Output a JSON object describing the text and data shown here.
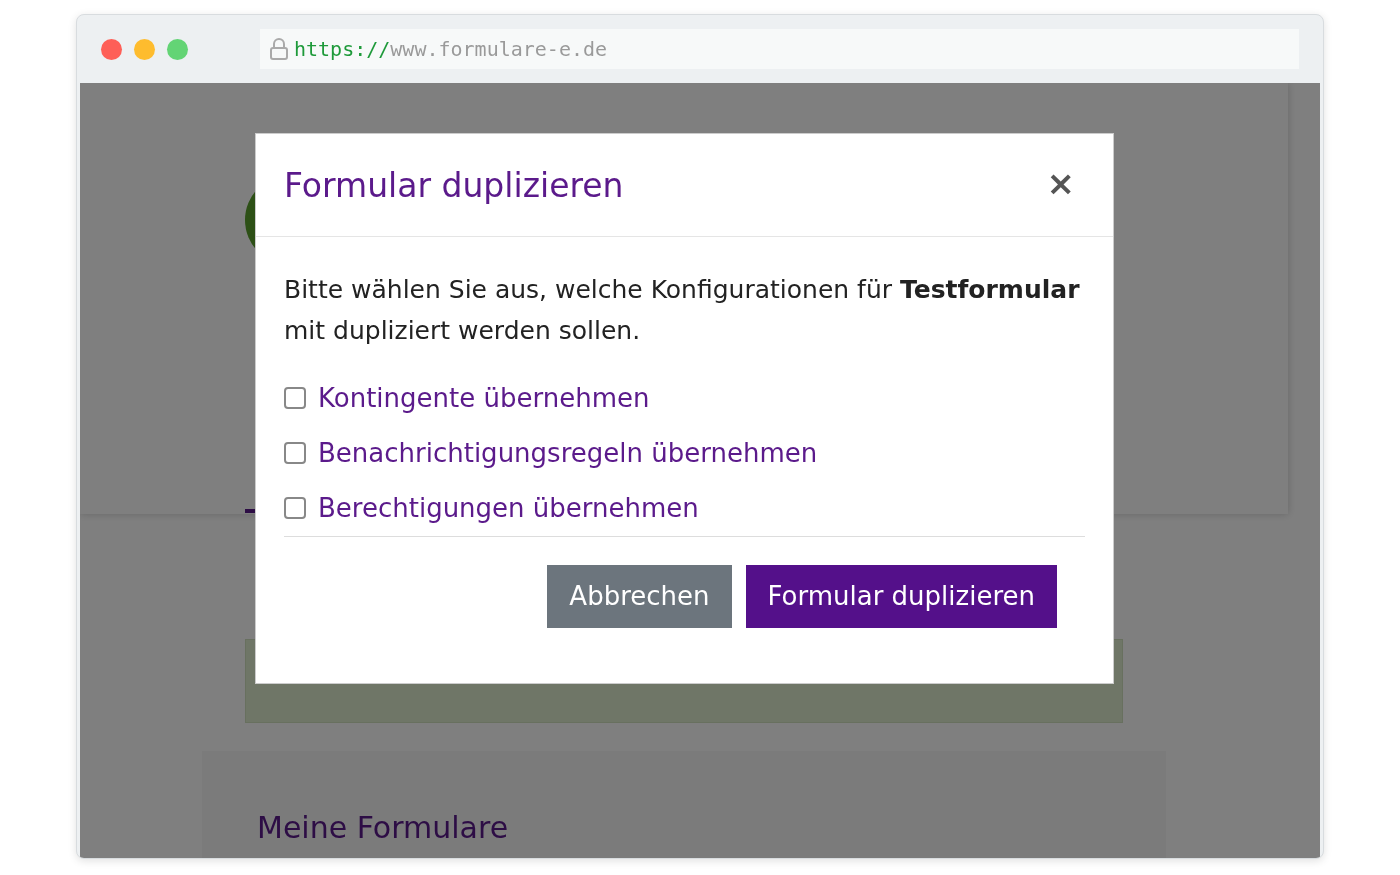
{
  "browser": {
    "url_scheme": "https://",
    "url_host": "www.formulare-e.de"
  },
  "page": {
    "section_title": "Meine Formulare"
  },
  "modal": {
    "title": "Formular duplizieren",
    "close": "×",
    "intro": "Bitte wählen Sie aus, welche Konfigurationen für **Testformular** mit dupliziert werden sollen.",
    "options": [
      {
        "label": "Kontingente übernehmen",
        "checked": false
      },
      {
        "label": "Benachrichtigungsregeln übernehmen",
        "checked": false
      },
      {
        "label": "Berechtigungen übernehmen",
        "checked": false
      }
    ],
    "buttons": [
      {
        "label": "Abbrechen",
        "kind": "secondary"
      },
      {
        "label": "Formular duplizieren",
        "kind": "primary"
      }
    ]
  }
}
